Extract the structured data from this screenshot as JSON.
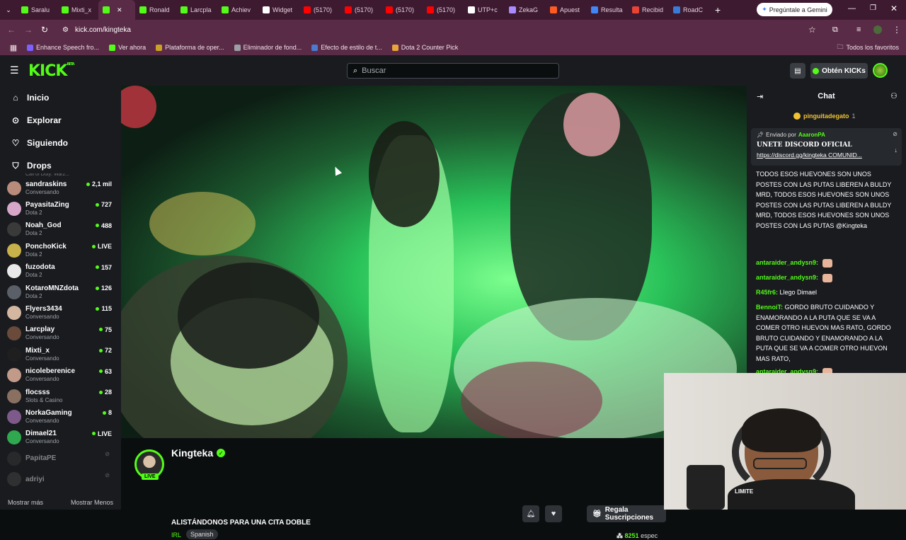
{
  "browser": {
    "tabs": [
      {
        "label": "Saralu",
        "icon": "kick-icon",
        "color": "#53fc18"
      },
      {
        "label": "Mixti_x",
        "icon": "kick-icon",
        "color": "#53fc18"
      },
      {
        "label": "",
        "icon": "kick-icon",
        "color": "#53fc18",
        "active": true
      },
      {
        "label": "Ronald",
        "icon": "kick-icon",
        "color": "#53fc18"
      },
      {
        "label": "Larcplа",
        "icon": "kick-icon",
        "color": "#53fc18"
      },
      {
        "label": "Achiev",
        "icon": "kick-icon",
        "color": "#53fc18"
      },
      {
        "label": "Widget",
        "icon": "widget-icon",
        "color": "#ffffff"
      },
      {
        "label": "(5170)",
        "icon": "youtube-icon",
        "color": "#ff0000"
      },
      {
        "label": "(5170)",
        "icon": "youtube-icon",
        "color": "#ff0000"
      },
      {
        "label": "(5170)",
        "icon": "youtube-icon",
        "color": "#ff0000"
      },
      {
        "label": "(5170)",
        "icon": "youtube-icon",
        "color": "#ff0000"
      },
      {
        "label": "UTP+c",
        "icon": "utp-icon",
        "color": "#ffffff"
      },
      {
        "label": "ZekaG",
        "icon": "zeka-icon",
        "color": "#a98bff"
      },
      {
        "label": "Apuest",
        "icon": "bet-icon",
        "color": "#ff5a1f"
      },
      {
        "label": "Resulta",
        "icon": "google-icon",
        "color": "#4285f4"
      },
      {
        "label": "Recibid",
        "icon": "gmail-icon",
        "color": "#ea4335"
      },
      {
        "label": "RoadC",
        "icon": "road-icon",
        "color": "#3a7bd5"
      }
    ],
    "gemini_button": "Pregúntale a Gemini",
    "url": "kick.com/kingteka",
    "bookmarks": [
      {
        "label": "Enhance Speech fro...",
        "color": "#7b61ff"
      },
      {
        "label": "Ver ahora",
        "color": "#53fc18"
      },
      {
        "label": "Plataforma de oper...",
        "color": "#c9a227"
      },
      {
        "label": "Eliminador de fond...",
        "color": "#9aa0a6"
      },
      {
        "label": "Efecto de estilo de t...",
        "color": "#4a7bd0"
      },
      {
        "label": "Dota 2 Counter Pick",
        "color": "#e8a33a"
      }
    ],
    "all_bookmarks": "Todos los favoritos"
  },
  "kick": {
    "logo": "KICK",
    "logo_beta": "BETA",
    "search_placeholder": "Buscar",
    "get_kicks": "Obtén KICKs",
    "nav": [
      {
        "label": "Inicio",
        "icon": "home-icon"
      },
      {
        "label": "Explorar",
        "icon": "compass-icon"
      },
      {
        "label": "Siguiendo",
        "icon": "heart-icon"
      },
      {
        "label": "Drops",
        "icon": "drops-icon"
      }
    ],
    "cut_text": "Call of Duty: Warz...",
    "channels": [
      {
        "name": "sandraskins",
        "game": "Conversando",
        "viewers": "2,1 mil",
        "color": "#b98b7a"
      },
      {
        "name": "PayasitaZing",
        "game": "Dota 2",
        "viewers": "727",
        "color": "#d7a7c9"
      },
      {
        "name": "Noah_God",
        "game": "Dota 2",
        "viewers": "488",
        "color": "#3a3a3a"
      },
      {
        "name": "PonchoKick",
        "game": "Dota 2",
        "viewers": "LIVE",
        "color": "#c8b04a"
      },
      {
        "name": "fuzodota",
        "game": "Dota 2",
        "viewers": "157",
        "color": "#e9e9e9"
      },
      {
        "name": "KotaroMNZdota",
        "game": "Dota 2",
        "viewers": "126",
        "color": "#5b6068"
      },
      {
        "name": "Flyers3434",
        "game": "Conversando",
        "viewers": "115",
        "color": "#d3b7a0"
      },
      {
        "name": "Larcplay",
        "game": "Conversando",
        "viewers": "75",
        "color": "#6a4a3a"
      },
      {
        "name": "Mixti_x",
        "game": "Conversando",
        "viewers": "72",
        "color": "#1f1f1f"
      },
      {
        "name": "nicoleberenice",
        "game": "Conversando",
        "viewers": "63",
        "color": "#c29a8a"
      },
      {
        "name": "flocsss",
        "game": "Slots & Casino",
        "viewers": "28",
        "color": "#8a7060"
      },
      {
        "name": "NorkaGaming",
        "game": "Conversando",
        "viewers": "8",
        "color": "#7d5a8a"
      },
      {
        "name": "Dimael21",
        "game": "Conversando",
        "viewers": "LIVE",
        "color": "#2fa84f"
      },
      {
        "name": "PapitaPE",
        "game": "",
        "viewers": "",
        "color": "#3a3a3a",
        "offline": true
      },
      {
        "name": "adriyi",
        "game": "",
        "viewers": "",
        "color": "#4a4a4a",
        "offline": true
      }
    ],
    "show_more": "Mostrar más",
    "show_less": "Mostrar Menos",
    "streamer": {
      "name": "Kingteka",
      "title": "ALISTÁNDONOS PARA UNA CITA DOBLE",
      "category": "IRL",
      "language": "Spanish",
      "live_badge": "LIVE",
      "viewers": "8251",
      "viewers_suffix": "espec",
      "gift_button": "Regala Suscripciones"
    },
    "chat": {
      "title": "Chat",
      "top_gifter": "pinguitadegato",
      "top_gifter_count": "1",
      "pinned_by_label": "Enviado por",
      "pinned_by_user": "AaaronPA",
      "pinned_text": "UNETE DISCORD OFICIAL",
      "pinned_link": "https://discord.gg/kingteka COMUNID...",
      "messages": [
        {
          "user": "",
          "text": "TODOS ESOS HUEVONES SON UNOS POSTES CON LAS PUTAS LIBEREN A BULDY MRD, TODOS ESOS HUEVONES SON UNOS POSTES CON LAS PUTAS LIBEREN A BULDY MRD, TODOS ESOS HUEVONES SON UNOS POSTES CON LAS PUTAS @Kingteka"
        },
        {
          "user": "antaraider_andysn9:",
          "text": ""
        },
        {
          "user": "antaraider_andysn9:",
          "text": ""
        },
        {
          "user": "R45fr6:",
          "text": "Llego Dimael"
        },
        {
          "user": "BennoiT:",
          "text": "GORDO BRUTO CUIDANDO Y ENAMORANDO A LA PUTA QUE SE VA A COMER OTRO HUEVON MAS RATO, GORDO BRUTO CUIDANDO Y ENAMORANDO A LA PUTA QUE SE VA A COMER OTRO HUEVON MAS RATO,"
        },
        {
          "user": "antaraider_andysn9:",
          "text": ""
        }
      ]
    },
    "webcam_cap_text": "LIMITE"
  },
  "colors": {
    "kick_green": "#53fc18",
    "browser_frame": "#5a2b46",
    "page_bg": "#0b0e0f",
    "panel_bg": "#191b1f"
  }
}
